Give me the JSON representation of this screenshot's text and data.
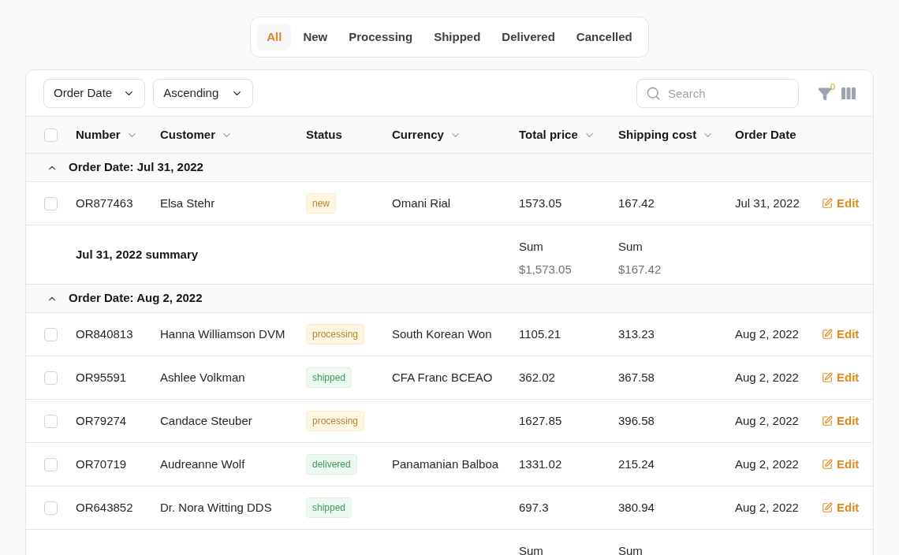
{
  "tabs": [
    {
      "label": "All",
      "selected": true
    },
    {
      "label": "New",
      "selected": false
    },
    {
      "label": "Processing",
      "selected": false
    },
    {
      "label": "Shipped",
      "selected": false
    },
    {
      "label": "Delivered",
      "selected": false
    },
    {
      "label": "Cancelled",
      "selected": false
    }
  ],
  "toolbar": {
    "sort_field": "Order Date",
    "sort_order": "Ascending",
    "search": {
      "placeholder": "Search"
    },
    "filter_count": "0"
  },
  "table": {
    "all_selected": false,
    "columns": [
      {
        "label": "Number",
        "sortable": true
      },
      {
        "label": "Customer",
        "sortable": true
      },
      {
        "label": "Status",
        "sortable": false
      },
      {
        "label": "Currency",
        "sortable": true
      },
      {
        "label": "Total price",
        "sortable": true
      },
      {
        "label": "Shipping cost",
        "sortable": true
      },
      {
        "label": "Order Date",
        "sortable": false
      }
    ],
    "groups": [
      {
        "title": "Order Date: Jul 31, 2022",
        "expanded": true,
        "rows": [
          {
            "selected": false,
            "number": "OR877463",
            "customer": "Elsa Stehr",
            "status": {
              "label": "new",
              "kind": "warning"
            },
            "currency": "Omani Rial",
            "total_price": "1573.05",
            "shipping_cost": "167.42",
            "order_date": "Jul 31, 2022",
            "action": "Edit"
          }
        ],
        "summary": {
          "label": "Jul 31, 2022 summary",
          "total_price": {
            "caption": "Sum",
            "value": "$1,573.05"
          },
          "shipping_cost": {
            "caption": "Sum",
            "value": "$167.42"
          }
        }
      },
      {
        "title": "Order Date: Aug 2, 2022",
        "expanded": true,
        "rows": [
          {
            "selected": false,
            "number": "OR840813",
            "customer": "Hanna Williamson DVM",
            "status": {
              "label": "processing",
              "kind": "warning"
            },
            "currency": "South Korean Won",
            "total_price": "1105.21",
            "shipping_cost": "313.23",
            "order_date": "Aug 2, 2022",
            "action": "Edit"
          },
          {
            "selected": false,
            "number": "OR95591",
            "customer": "Ashlee Volkman",
            "status": {
              "label": "shipped",
              "kind": "success"
            },
            "currency": "CFA Franc BCEAO",
            "total_price": "362.02",
            "shipping_cost": "367.58",
            "order_date": "Aug 2, 2022",
            "action": "Edit"
          },
          {
            "selected": false,
            "number": "OR79274",
            "customer": "Candace Steuber",
            "status": {
              "label": "processing",
              "kind": "warning"
            },
            "total_price": "1627.85",
            "shipping_cost": "396.58",
            "order_date": "Aug 2, 2022",
            "action": "Edit"
          },
          {
            "selected": false,
            "number": "OR70719",
            "customer": "Audreanne Wolf",
            "status": {
              "label": "delivered",
              "kind": "success"
            },
            "currency": "Panamanian Balboa",
            "total_price": "1331.02",
            "shipping_cost": "215.24",
            "order_date": "Aug 2, 2022",
            "action": "Edit"
          },
          {
            "selected": false,
            "number": "OR643852",
            "customer": "Dr. Nora Witting DDS",
            "status": {
              "label": "shipped",
              "kind": "success"
            },
            "total_price": "697.3",
            "shipping_cost": "380.94",
            "order_date": "Aug 2, 2022",
            "action": "Edit"
          }
        ],
        "summary": {
          "total_price": {
            "caption": "Sum"
          },
          "shipping_cost": {
            "caption": "Sum"
          }
        }
      }
    ]
  }
}
